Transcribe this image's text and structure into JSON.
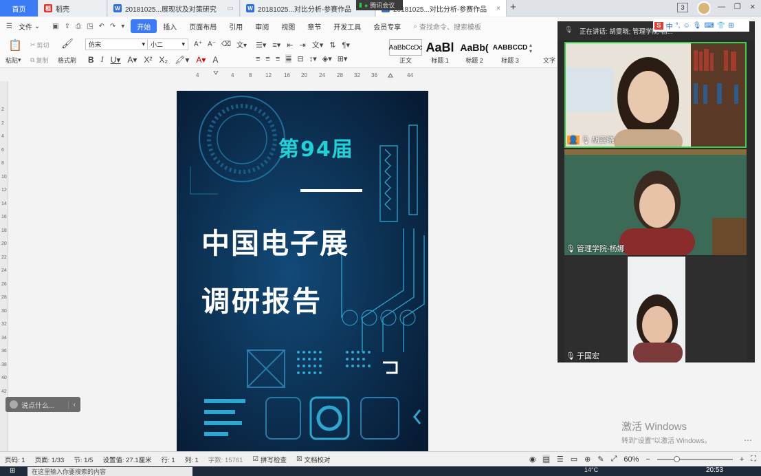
{
  "tabs": [
    {
      "label": "首页",
      "type": "home"
    },
    {
      "label": "稻壳",
      "type": "docer"
    },
    {
      "label": "20181025...展现状及对策研究",
      "type": "doc"
    },
    {
      "label": "20181025...对比分析-参赛作品",
      "type": "doc"
    },
    {
      "label": "20181025...对比分析-参赛作品",
      "type": "doc-active"
    }
  ],
  "tencent_badge": "腾讯会议",
  "window_controls": {
    "count": "3"
  },
  "menu": {
    "file": "文件",
    "items": [
      "开始",
      "插入",
      "页面布局",
      "引用",
      "审阅",
      "视图",
      "章节",
      "开发工具",
      "会员专享"
    ],
    "search_placeholder": "查找命令、搜索模板"
  },
  "ribbon": {
    "paste": "粘贴",
    "cut": "剪切",
    "copy": "复制",
    "format_painter": "格式刷",
    "font_name": "仿宋",
    "font_size": "小二",
    "styles": [
      {
        "preview": "AaBbCcDc",
        "name": "正文"
      },
      {
        "preview": "AaBl",
        "name": "标题 1"
      },
      {
        "preview": "AaBb(",
        "name": "标题 2"
      },
      {
        "preview": "AABBCCD",
        "name": "标题 3"
      }
    ],
    "text_tool": "文字"
  },
  "ruler_ticks": [
    "4",
    "4",
    "8",
    "12",
    "16",
    "20",
    "24",
    "28",
    "32",
    "36",
    "44"
  ],
  "vruler_ticks": [
    "2",
    "2",
    "4",
    "6",
    "8",
    "10",
    "12",
    "14",
    "16",
    "18",
    "20",
    "22",
    "24",
    "26",
    "28",
    "30",
    "32",
    "34",
    "36",
    "38",
    "40",
    "42"
  ],
  "cover": {
    "edition": "第94届",
    "title_line1": "中国电子展",
    "title_line2": "调研报告"
  },
  "say_box": "说点什么...",
  "statusbar": {
    "page_num": "页码: 1",
    "pages": "页面: 1/33",
    "section": "节: 1/5",
    "setting": "设置值: 27.1厘米",
    "row": "行: 1",
    "col": "列: 1",
    "word_count": "字数: 15761",
    "spell_check": "拼写检查",
    "doc_proof": "文档校对",
    "zoom": "60%"
  },
  "meeting": {
    "speaking": "正在讲话: 胡雯晓; 管理学院-杨...",
    "participants": [
      {
        "name": "胡雯晓"
      },
      {
        "name": "管理学院-杨娜"
      },
      {
        "name": "于国宏"
      }
    ]
  },
  "watermark": {
    "title": "激活 Windows",
    "subtitle": "转到\"设置\"以激活 Windows。"
  },
  "taskbar": {
    "time": "20:53",
    "search_placeholder": "在这里输入你要搜索的内容",
    "temp": "14°C"
  },
  "ime": {
    "lang": "中"
  }
}
